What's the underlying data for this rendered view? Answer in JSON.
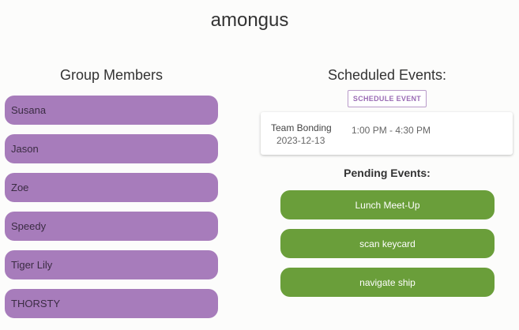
{
  "group": {
    "name": "amongus"
  },
  "members": {
    "title": "Group Members",
    "items": [
      "Susana",
      "Jason",
      "Zoe",
      "Speedy",
      "Tiger Lily",
      "THORSTY"
    ]
  },
  "scheduled": {
    "title": "Scheduled Events:",
    "schedule_button_label": "SCHEDULE EVENT",
    "events": [
      {
        "name": "Team Bonding",
        "date": "2023-12-13",
        "time": "1:00 PM - 4:30 PM"
      }
    ]
  },
  "pending": {
    "title": "Pending Events:",
    "items": [
      "Lunch Meet-Up",
      "scan keycard",
      "navigate ship"
    ]
  },
  "colors": {
    "member_pill": "#a77cbb",
    "pending_pill": "#6a9e3a",
    "accent": "#9a6bb4"
  }
}
